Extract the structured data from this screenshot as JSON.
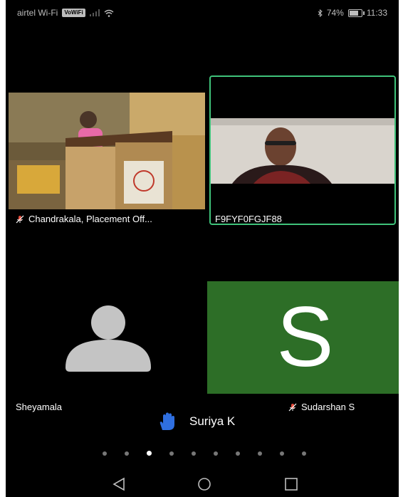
{
  "status_bar": {
    "carrier": "airtel Wi-Fi",
    "volte": "VoWiFi",
    "battery": "74%",
    "battery_level": 0.74,
    "time": "11:33"
  },
  "participants": [
    {
      "name": "Chandrakala, Placement Off...",
      "muted": true,
      "type": "video"
    },
    {
      "name": "F9FYF0FGJF88",
      "muted": false,
      "type": "video",
      "active_speaker": true
    },
    {
      "name": "Sheyamala",
      "muted": false,
      "type": "avatar"
    },
    {
      "name": "Sudarshan S",
      "muted": true,
      "type": "initial",
      "initial": "S",
      "color": "#2d6e27"
    }
  ],
  "raised_hand": {
    "name": "Suriya K",
    "icon": "raised-hand-icon",
    "color": "#2f6fe0"
  },
  "pager": {
    "count": 10,
    "active_index": 2
  },
  "nav": {
    "back": "back-icon",
    "home": "home-icon",
    "recents": "recents-icon"
  },
  "colors": {
    "active_border": "#3fc27a",
    "tile_green": "#2d6e27"
  }
}
